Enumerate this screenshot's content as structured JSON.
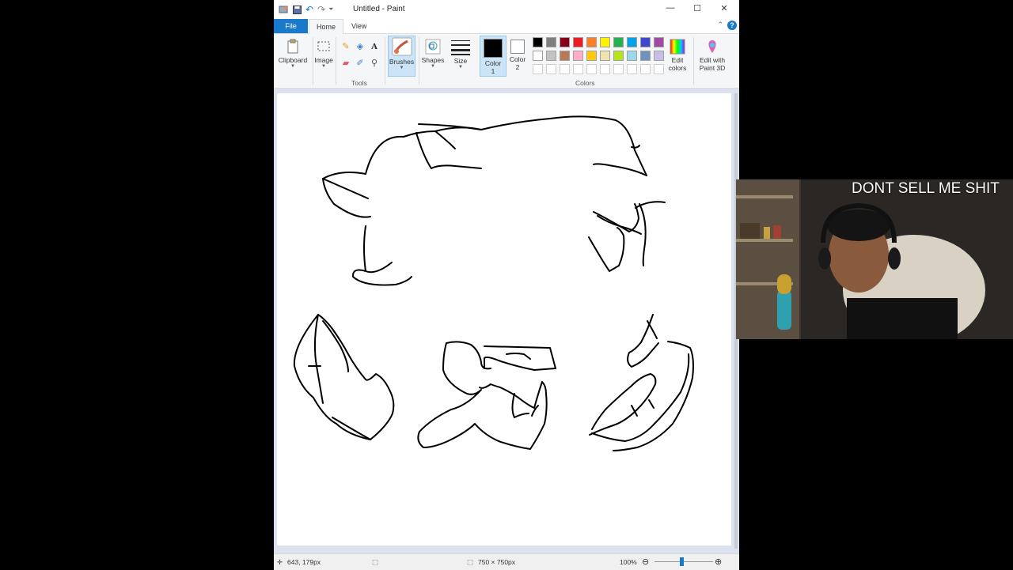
{
  "window": {
    "title": "Untitled - Paint",
    "controls": {
      "minimize": "—",
      "maximize": "☐",
      "close": "✕"
    }
  },
  "menu": {
    "file": "File",
    "tabs": [
      "Home",
      "View"
    ],
    "help": "?"
  },
  "ribbon": {
    "clipboard": "Clipboard",
    "image": "Image",
    "tools_group": "Tools",
    "brushes": "Brushes",
    "shapes": "Shapes",
    "size": "Size",
    "color1_line1": "Color",
    "color1_line2": "1",
    "color2_line1": "Color",
    "color2_line2": "2",
    "edit_colors_line1": "Edit",
    "edit_colors_line2": "colors",
    "paint3d_line1": "Edit with",
    "paint3d_line2": "Paint 3D",
    "colors_group": "Colors",
    "palette_row1": [
      "#000000",
      "#7f7f7f",
      "#880015",
      "#ed1c24",
      "#ff7f27",
      "#fff200",
      "#22b14c",
      "#00a2e8",
      "#3f48cc",
      "#a349a4"
    ],
    "palette_row2": [
      "#ffffff",
      "#c3c3c3",
      "#b97a57",
      "#ffaec9",
      "#ffc90e",
      "#efe4b0",
      "#b5e61d",
      "#99d9ea",
      "#7092be",
      "#c8bfe7"
    ],
    "color1": "#000000",
    "color2": "#ffffff"
  },
  "status": {
    "cursor_pos": "643, 179px",
    "canvas_size": "750 × 750px",
    "zoom": "100%"
  },
  "stream": {
    "overlay_text": "DONT SELL ME SHIT"
  }
}
